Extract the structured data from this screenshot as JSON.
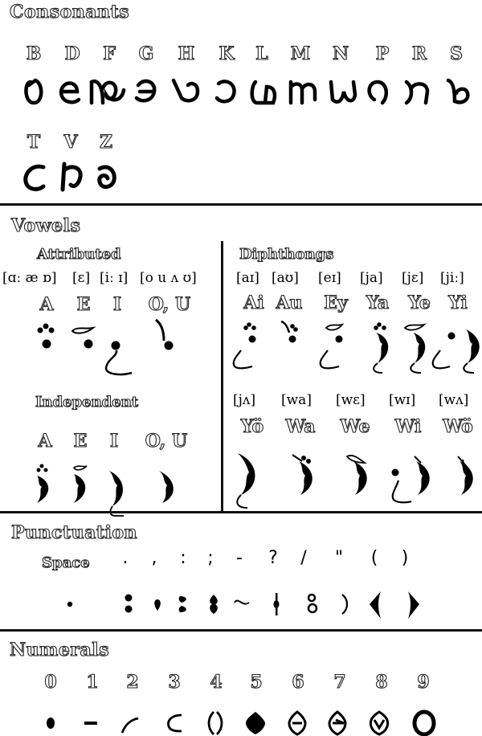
{
  "consonants": {
    "title": "Consonants",
    "letters": [
      "B",
      "D",
      "F",
      "G",
      "H",
      "K",
      "L",
      "M",
      "N",
      "P",
      "R",
      "S",
      "T",
      "V",
      "Z"
    ]
  },
  "vowels": {
    "title": "Vowels",
    "attributed": {
      "title": "Attributed",
      "ipa": [
        "[ɑː æ ɒ]",
        "[ɛ]",
        "[iː ɪ]",
        "[o u ʌ ʊ]"
      ],
      "letters": [
        "A",
        "E",
        "I",
        "O, U"
      ]
    },
    "independent": {
      "title": "Independent",
      "letters": [
        "A",
        "E",
        "I",
        "O, U"
      ]
    },
    "diphthongs": {
      "title": "Diphthongs",
      "row1": {
        "ipa": [
          "[aɪ]",
          "[aʊ]",
          "[eɪ]",
          "[ja]",
          "[jɛ]",
          "[jiː]"
        ],
        "letters": [
          "Ai",
          "Au",
          "Ey",
          "Ya",
          "Ye",
          "Yi"
        ]
      },
      "row2": {
        "ipa": [
          "[jʌ]",
          "[wa]",
          "[wɛ]",
          "[wɪ]",
          "[wʌ]"
        ],
        "letters": [
          "Yö",
          "Wa",
          "We",
          "Wi",
          "Wö"
        ]
      }
    }
  },
  "punctuation": {
    "title": "Punctuation",
    "labels": [
      "Space",
      ".",
      ",",
      ":",
      ";",
      "-",
      "?",
      "/",
      "\"",
      "(",
      ")"
    ]
  },
  "numerals": {
    "title": "Numerals",
    "digits": [
      "0",
      "1",
      "2",
      "3",
      "4",
      "5",
      "6",
      "7",
      "8",
      "9"
    ]
  }
}
